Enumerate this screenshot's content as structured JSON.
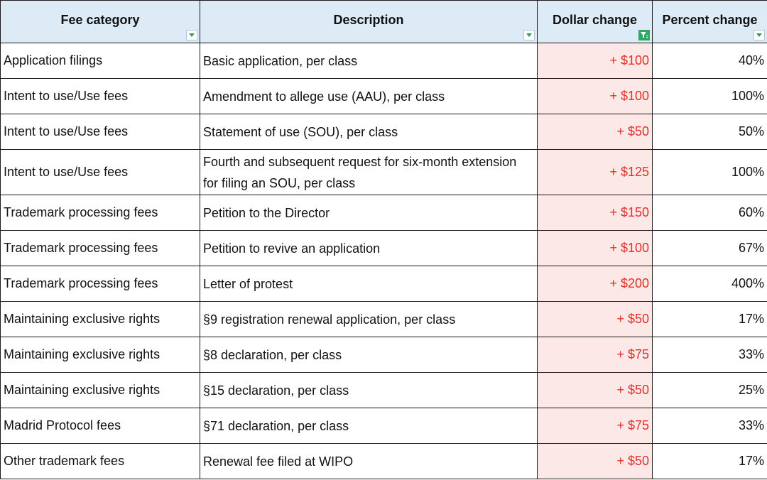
{
  "header": {
    "col1": "Fee category",
    "col2": "Description",
    "col3": "Dollar change",
    "col4": "Percent change"
  },
  "icons": {
    "dropdown": "dropdown-arrow-icon",
    "filter": "filter-active-icon",
    "filter_color": "#2fa865",
    "dollar_color": "#e0302b",
    "dollar_bg": "#fce8e6",
    "header_bg": "#ddebf7"
  },
  "rows": [
    {
      "category": "Application filings",
      "description": "Basic application, per class",
      "dollar": "+ $100",
      "percent": "40%"
    },
    {
      "category": "Intent to use/Use fees",
      "description": "Amendment to allege use (AAU), per class",
      "dollar": "+ $100",
      "percent": "100%"
    },
    {
      "category": "Intent to use/Use fees",
      "description": "Statement of use (SOU), per class",
      "dollar": "+ $50",
      "percent": "50%"
    },
    {
      "category": "Intent to use/Use fees",
      "description": "Fourth and subsequent request for six-month extension for filing an SOU, per class",
      "dollar": "+ $125",
      "percent": "100%"
    },
    {
      "category": "Trademark processing fees",
      "description": "Petition to the Director",
      "dollar": "+ $150",
      "percent": "60%"
    },
    {
      "category": "Trademark processing fees",
      "description": "Petition to revive an application",
      "dollar": "+ $100",
      "percent": "67%"
    },
    {
      "category": "Trademark processing fees",
      "description": "Letter of protest",
      "dollar": "+ $200",
      "percent": "400%"
    },
    {
      "category": "Maintaining exclusive rights",
      "description": "§9 registration renewal application, per class",
      "dollar": "+ $50",
      "percent": "17%"
    },
    {
      "category": "Maintaining exclusive rights",
      "description": "§8 declaration, per class",
      "dollar": "+ $75",
      "percent": "33%"
    },
    {
      "category": "Maintaining exclusive rights",
      "description": "§15 declaration, per class",
      "dollar": "+ $50",
      "percent": "25%"
    },
    {
      "category": "Madrid Protocol fees",
      "description": "§71 declaration, per class",
      "dollar": "+ $75",
      "percent": "33%"
    },
    {
      "category": "Other trademark fees",
      "description": "Renewal fee filed at WIPO",
      "dollar": "+ $50",
      "percent": "17%"
    }
  ]
}
